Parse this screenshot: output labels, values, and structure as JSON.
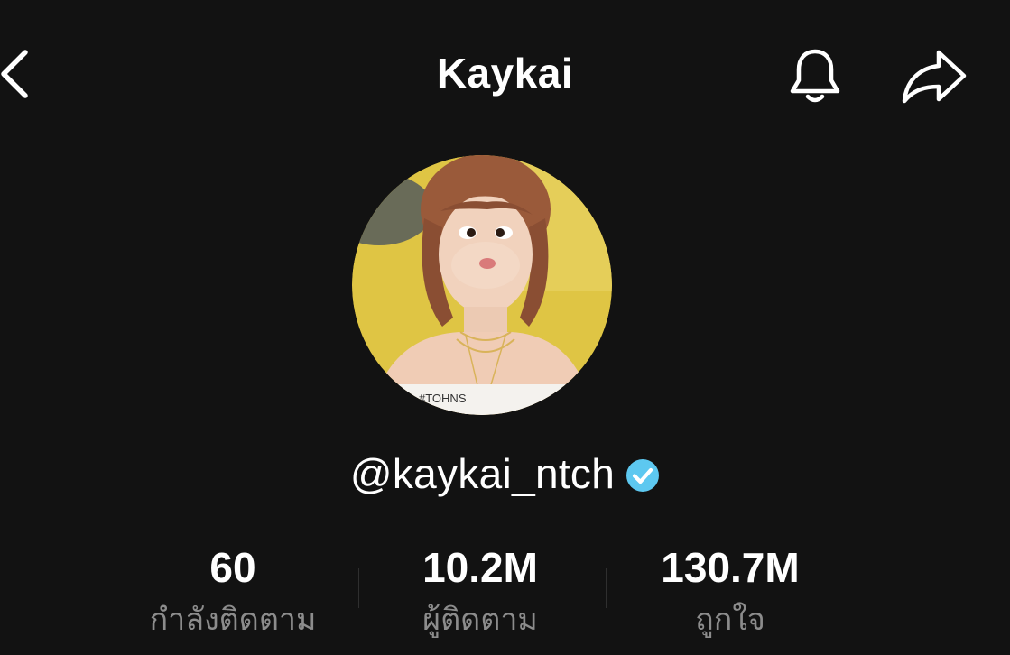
{
  "header": {
    "title": "Kaykai",
    "back_icon": "chevron-left-icon",
    "bell_icon": "bell-icon",
    "share_icon": "share-arrow-icon"
  },
  "profile": {
    "avatar_desc": "profile-photo",
    "handle": "@kaykai_ntch",
    "verified": true,
    "verified_color": "#5dc8f0"
  },
  "stats": [
    {
      "value": "60",
      "label": "กำลังติดตาม"
    },
    {
      "value": "10.2M",
      "label": "ผู้ติดตาม"
    },
    {
      "value": "130.7M",
      "label": "ถูกใจ"
    }
  ],
  "colors": {
    "background": "#121212",
    "text": "#ffffff",
    "muted": "#8c8c8c"
  }
}
